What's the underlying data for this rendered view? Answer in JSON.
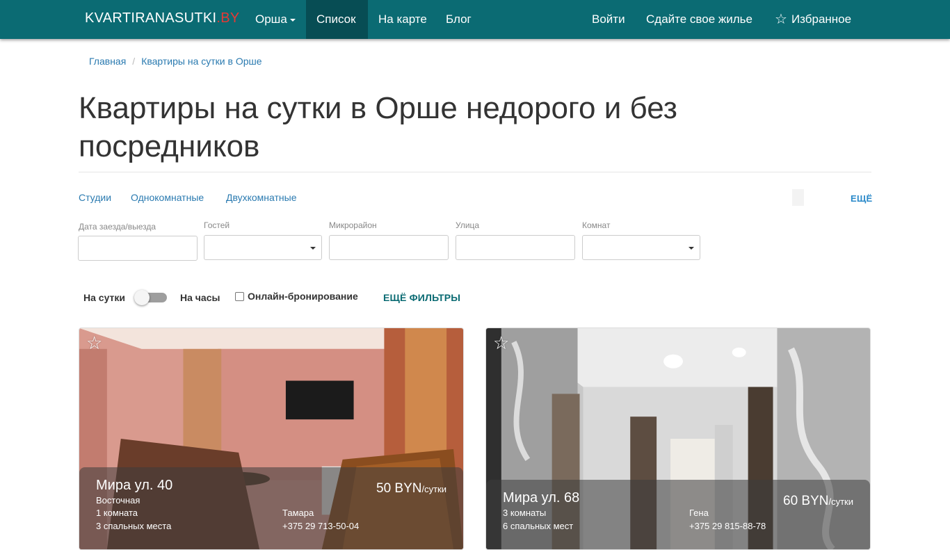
{
  "navbar": {
    "brand_main": "KVARTIRANASUTKI",
    "brand_suffix": ".BY",
    "city": "Орша",
    "list": "Список",
    "map": "На карте",
    "blog": "Блог",
    "login": "Войти",
    "rent_out": "Сдайте свое жилье",
    "favorites": "Избранное",
    "colors": {
      "bar": "#0b6b73",
      "active": "#074d54",
      "brand_suffix": "#e53935"
    }
  },
  "breadcrumb": {
    "home": "Главная",
    "separator": "/",
    "current": "Квартиры на сутки в Орше"
  },
  "page_title": "Квартиры на сутки в Орше недорого и без посредников",
  "categories": {
    "studios": "Студии",
    "one_room": "Однокомнатные",
    "two_room": "Двухкомнатные",
    "more": "ЕЩЁ"
  },
  "filters": {
    "dates_label": "Дата заезда/выезда",
    "dates_value": "",
    "guests_label": "Гостей",
    "guests_value": "",
    "district_label": "Микрорайон",
    "district_value": "",
    "street_label": "Улица",
    "street_value": "",
    "rooms_label": "Комнат",
    "rooms_value": ""
  },
  "toggles": {
    "per_day": "На сутки",
    "per_hour": "На часы",
    "online_booking": "Онлайн-бронирование",
    "online_booking_checked": false,
    "more_filters": "ЕЩЁ ФИЛЬТРЫ"
  },
  "listings": [
    {
      "address": "Мира ул. 40",
      "district": "Восточная",
      "rooms": "1 комната",
      "beds": "3 спальных места",
      "price": "50 BYN",
      "price_unit": "/сутки",
      "owner": "Тамара",
      "phone": "+375 29 713-50-04"
    },
    {
      "address": "Мира ул. 68",
      "rooms": "3 комнаты",
      "beds": "6 спальных мест",
      "price": "60 BYN",
      "price_unit": "/сутки",
      "owner": "Гена",
      "phone": "+375 29 815-88-78"
    }
  ]
}
